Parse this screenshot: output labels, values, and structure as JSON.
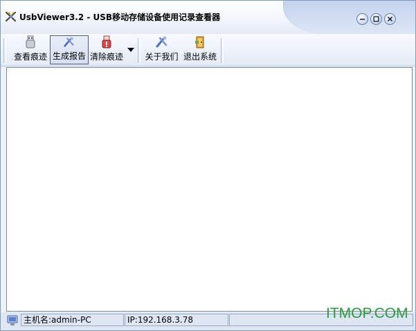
{
  "window": {
    "title": "UsbViewer3.2 - USB移动存储设备使用记录查看器"
  },
  "toolbar": {
    "view_traces": "查看痕迹",
    "generate_report": "生成报告",
    "clear_traces": "清除痕迹",
    "about_us": "关于我们",
    "exit_system": "退出系统"
  },
  "statusbar": {
    "hostname": "主机名:admin-PC",
    "ip": "IP:192.168.3.78",
    "extra": ""
  },
  "watermark": "ITMOP.COM",
  "colors": {
    "accent": "#7f9db9",
    "watermark": "#2b9b3e"
  }
}
